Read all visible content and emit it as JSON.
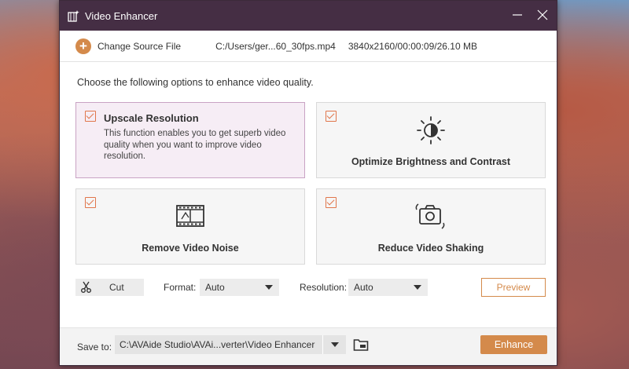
{
  "window": {
    "title": "Video Enhancer"
  },
  "source": {
    "change_label": "Change Source File",
    "file_path": "C:/Users/ger...60_30fps.mp4",
    "file_info": "3840x2160/00:00:09/26.10 MB"
  },
  "instruction": "Choose the following options to enhance video quality.",
  "options": [
    {
      "title": "Upscale Resolution",
      "description": "This function enables you to get superb video quality when you want to improve video resolution.",
      "checked": true
    },
    {
      "title": "Optimize Brightness and Contrast",
      "checked": true
    },
    {
      "title": "Remove Video Noise",
      "checked": true
    },
    {
      "title": "Reduce Video Shaking",
      "checked": true
    }
  ],
  "toolbar": {
    "cut_label": "Cut",
    "format_label": "Format:",
    "format_value": "Auto",
    "resolution_label": "Resolution:",
    "resolution_value": "Auto",
    "preview_label": "Preview"
  },
  "footer": {
    "save_label": "Save to:",
    "save_path": "C:\\AVAide Studio\\AVAi...verter\\Video Enhancer",
    "enhance_label": "Enhance"
  },
  "colors": {
    "accent": "#d48a4b",
    "titlebar": "#452e44",
    "selected_bg": "#f6edf5",
    "checkbox": "#e0764b"
  },
  "icons": [
    "app-icon",
    "minimize-icon",
    "close-icon",
    "plus-icon",
    "brightness-icon",
    "film-icon",
    "camera-shake-icon",
    "scissors-icon",
    "folder-icon"
  ]
}
